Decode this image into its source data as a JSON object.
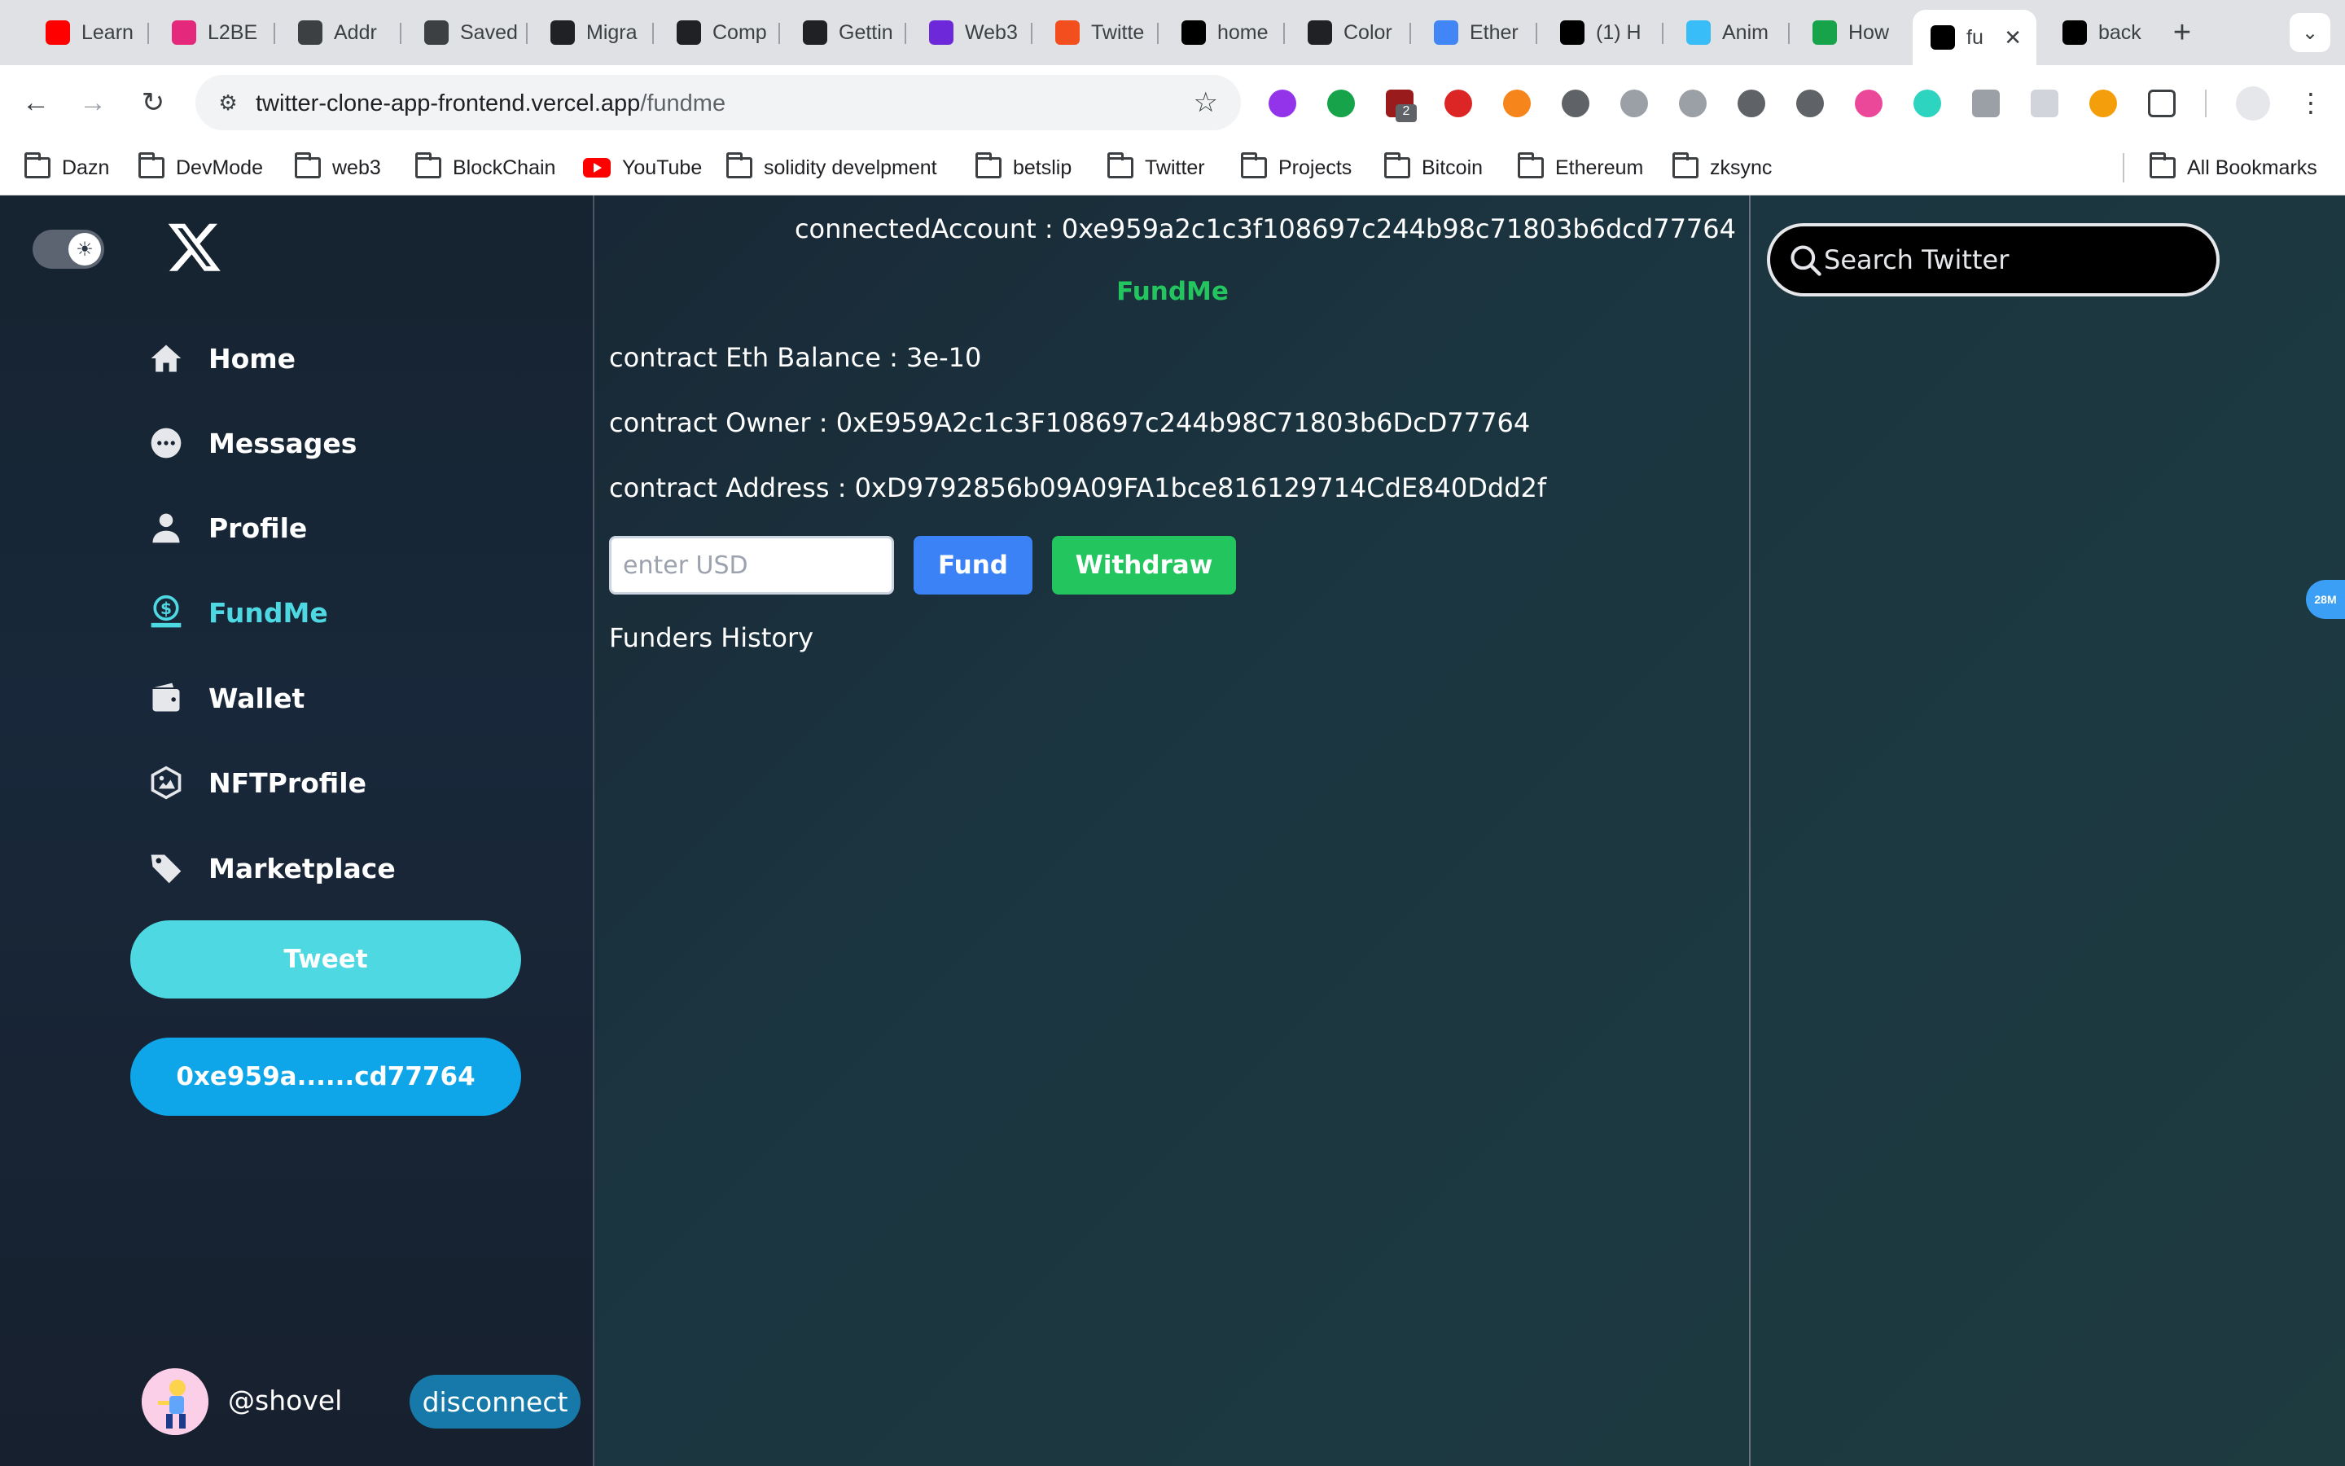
{
  "browser": {
    "tabs": [
      {
        "title": "Learn",
        "icon": "youtube-icon",
        "color": "#ff0000"
      },
      {
        "title": "L2BE",
        "icon": "l2beat-icon",
        "color": "#e4287b"
      },
      {
        "title": "Addr",
        "icon": "globe-icon",
        "color": "#3c4043"
      },
      {
        "title": "Saved",
        "icon": "chatgpt-icon",
        "color": "#3c4043"
      },
      {
        "title": "Migra",
        "icon": "docs-icon",
        "color": "#202124"
      },
      {
        "title": "Comp",
        "icon": "docs-icon",
        "color": "#202124"
      },
      {
        "title": "Gettin",
        "icon": "docs-icon",
        "color": "#202124"
      },
      {
        "title": "Web3",
        "icon": "web3-icon",
        "color": "#6d28d9"
      },
      {
        "title": "Twitte",
        "icon": "figma-icon",
        "color": "#f24e1e"
      },
      {
        "title": "home",
        "icon": "vercel-icon",
        "color": "#000000"
      },
      {
        "title": "Color",
        "icon": "color-icon",
        "color": "#202124"
      },
      {
        "title": "Ether",
        "icon": "cloud-icon",
        "color": "#4285f4"
      },
      {
        "title": "(1) H",
        "icon": "x-icon",
        "color": "#000000"
      },
      {
        "title": "Anim",
        "icon": "tailwind-icon",
        "color": "#38bdf8"
      },
      {
        "title": "How",
        "icon": "w-icon",
        "color": "#16a34a"
      },
      {
        "title": "fu",
        "icon": "vercel-icon",
        "color": "#000000",
        "active": true
      },
      {
        "title": "back",
        "icon": "vercel-icon",
        "color": "#000000"
      }
    ],
    "url_host": "twitter-clone-app-frontend.vercel.app",
    "url_path": "/fundme",
    "bookmarks": [
      {
        "label": "Dazn",
        "type": "folder"
      },
      {
        "label": "DevMode",
        "type": "folder"
      },
      {
        "label": "web3",
        "type": "folder"
      },
      {
        "label": "BlockChain",
        "type": "folder"
      },
      {
        "label": "YouTube",
        "type": "youtube"
      },
      {
        "label": "solidity develpment",
        "type": "folder"
      },
      {
        "label": "betslip",
        "type": "folder"
      },
      {
        "label": "Twitter",
        "type": "folder"
      },
      {
        "label": "Projects",
        "type": "folder"
      },
      {
        "label": "Bitcoin",
        "type": "folder"
      },
      {
        "label": "Ethereum",
        "type": "folder"
      },
      {
        "label": "zksync",
        "type": "folder"
      }
    ],
    "all_bookmarks": "All Bookmarks",
    "extension_badge": "2"
  },
  "sidebar": {
    "nav": [
      {
        "label": "Home",
        "icon": "home-icon"
      },
      {
        "label": "Messages",
        "icon": "chat-icon"
      },
      {
        "label": "Profile",
        "icon": "user-icon"
      },
      {
        "label": "FundMe",
        "icon": "dollar-hand-icon",
        "active": true
      },
      {
        "label": "Wallet",
        "icon": "wallet-icon"
      },
      {
        "label": "NFTProfile",
        "icon": "nft-icon"
      },
      {
        "label": "Marketplace",
        "icon": "tag-icon"
      }
    ],
    "tweet_label": "Tweet",
    "account_label": "0xe959a......cd77764",
    "handle": "@shovel",
    "disconnect_label": "disconnect",
    "accent": "#4dd8e2"
  },
  "main": {
    "connected_account": "connectedAccount : 0xe959a2c1c3f108697c244b98c71803b6dcd77764",
    "heading": "FundMe",
    "balance": "contract Eth Balance : 3e-10",
    "owner": "contract Owner : 0xE959A2c1c3F108697c244b98C71803b6DcD77764",
    "address": "contract Address : 0xD9792856b09A09FA1bce816129714CdE840Ddd2f",
    "usd_placeholder": "enter USD",
    "fund_label": "Fund",
    "withdraw_label": "Withdraw",
    "funders_history": "Funders History"
  },
  "right": {
    "search_placeholder": "Search Twitter",
    "side_badge": "28M"
  }
}
